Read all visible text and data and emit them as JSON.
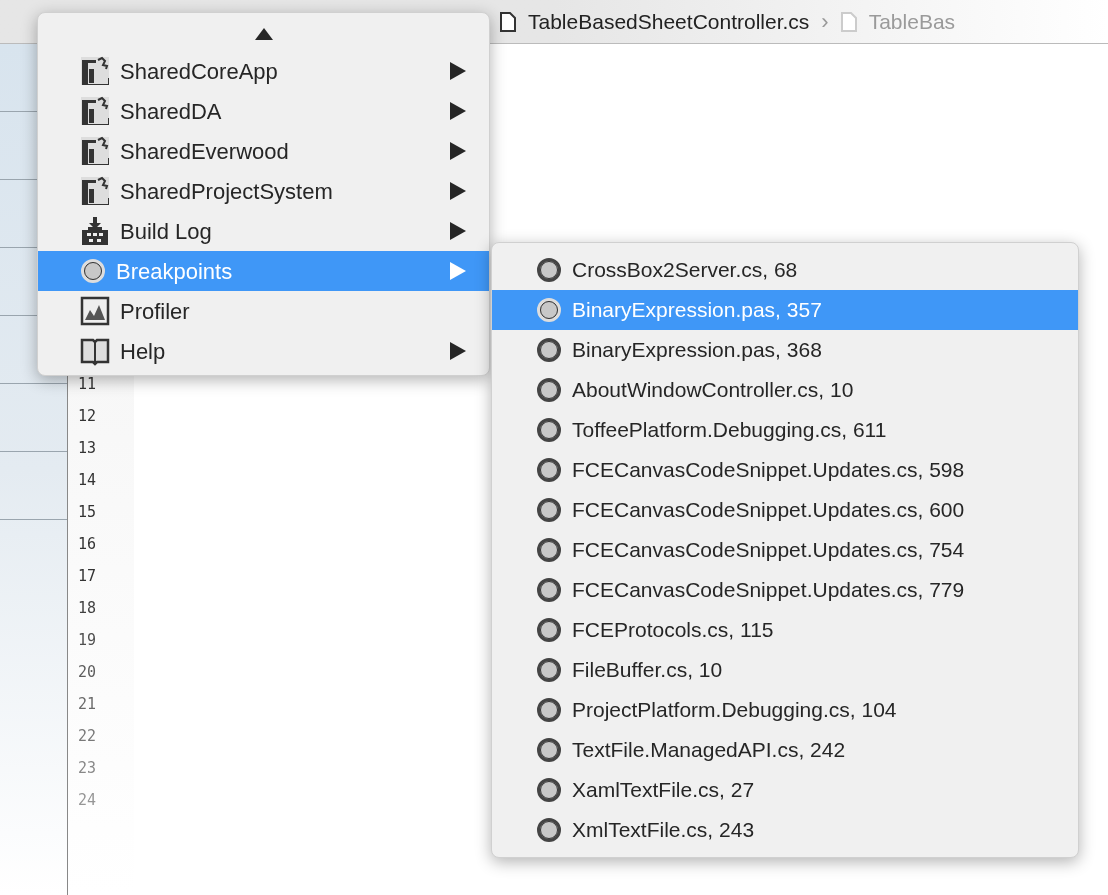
{
  "breadcrumb": {
    "separator": "›",
    "items": [
      {
        "label": "TableBasedSheetController.cs",
        "faded": false
      },
      {
        "label": "TableBas",
        "faded": true
      }
    ]
  },
  "line_numbers": [
    "11",
    "12",
    "13",
    "14",
    "15",
    "16",
    "17",
    "18",
    "19",
    "20",
    "21",
    "22",
    "23",
    "24"
  ],
  "menu": {
    "items": [
      {
        "label": "SharedCoreApp",
        "kind": "project",
        "has_submenu": true,
        "selected": false
      },
      {
        "label": "SharedDA",
        "kind": "project",
        "has_submenu": true,
        "selected": false
      },
      {
        "label": "SharedEverwood",
        "kind": "project",
        "has_submenu": true,
        "selected": false
      },
      {
        "label": "SharedProjectSystem",
        "kind": "project",
        "has_submenu": true,
        "selected": false
      },
      {
        "label": "Build Log",
        "kind": "build",
        "has_submenu": true,
        "selected": false
      },
      {
        "label": "Breakpoints",
        "kind": "breakpoint",
        "has_submenu": true,
        "selected": true
      },
      {
        "label": "Profiler",
        "kind": "profiler",
        "has_submenu": false,
        "selected": false
      },
      {
        "label": "Help",
        "kind": "help",
        "has_submenu": true,
        "selected": false
      }
    ]
  },
  "submenu": {
    "items": [
      {
        "label": "CrossBox2Server.cs, 68",
        "selected": false
      },
      {
        "label": "BinaryExpression.pas, 357",
        "selected": true
      },
      {
        "label": "BinaryExpression.pas, 368",
        "selected": false
      },
      {
        "label": "AboutWindowController.cs, 10",
        "selected": false
      },
      {
        "label": "ToffeePlatform.Debugging.cs, 611",
        "selected": false
      },
      {
        "label": "FCECanvasCodeSnippet.Updates.cs, 598",
        "selected": false
      },
      {
        "label": "FCECanvasCodeSnippet.Updates.cs, 600",
        "selected": false
      },
      {
        "label": "FCECanvasCodeSnippet.Updates.cs, 754",
        "selected": false
      },
      {
        "label": "FCECanvasCodeSnippet.Updates.cs, 779",
        "selected": false
      },
      {
        "label": "FCEProtocols.cs, 115",
        "selected": false
      },
      {
        "label": "FileBuffer.cs, 10",
        "selected": false
      },
      {
        "label": "ProjectPlatform.Debugging.cs, 104",
        "selected": false
      },
      {
        "label": "TextFile.ManagedAPI.cs, 242",
        "selected": false
      },
      {
        "label": "XamlTextFile.cs, 27",
        "selected": false
      },
      {
        "label": "XmlTextFile.cs, 243",
        "selected": false
      }
    ]
  }
}
